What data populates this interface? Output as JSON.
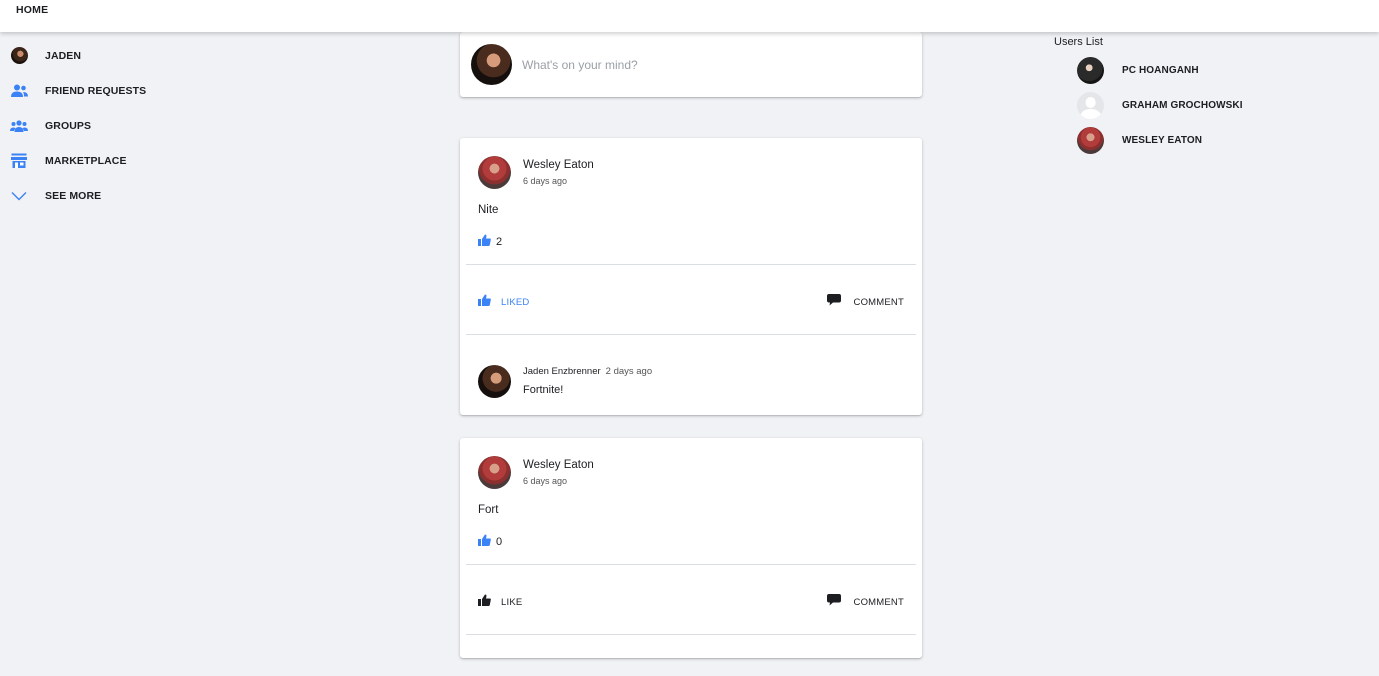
{
  "topbar": {
    "home_label": "HOME"
  },
  "sidebar": {
    "items": [
      {
        "label": "JADEN",
        "icon": "user-avatar"
      },
      {
        "label": "FRIEND REQUESTS",
        "icon": "people-icon"
      },
      {
        "label": "GROUPS",
        "icon": "groups-icon"
      },
      {
        "label": "MARKETPLACE",
        "icon": "store-icon"
      },
      {
        "label": "SEE MORE",
        "icon": "chevron-down-icon"
      }
    ]
  },
  "composer": {
    "placeholder": "What's on your mind?"
  },
  "posts": [
    {
      "author": "Wesley Eaton",
      "time": "6 days ago",
      "text": "Nite",
      "likes": "2",
      "like_label": "LIKED",
      "comment_label": "COMMENT",
      "comments": [
        {
          "author": "Jaden Enzbrenner",
          "time": "2 days ago",
          "text": "Fortnite!"
        }
      ]
    },
    {
      "author": "Wesley Eaton",
      "time": "6 days ago",
      "text": "Fort",
      "likes": "0",
      "like_label": "LIKE",
      "comment_label": "COMMENT",
      "comments": []
    }
  ],
  "users_list": {
    "title": "Users List",
    "users": [
      {
        "name": "PC HOANGANH"
      },
      {
        "name": "GRAHAM GROCHOWSKI"
      },
      {
        "name": "WESLEY EATON"
      }
    ]
  },
  "colors": {
    "accent": "#3b82f6",
    "background": "#f0f2f5",
    "liked": "#3b82f6",
    "text": "#1c1e21"
  }
}
